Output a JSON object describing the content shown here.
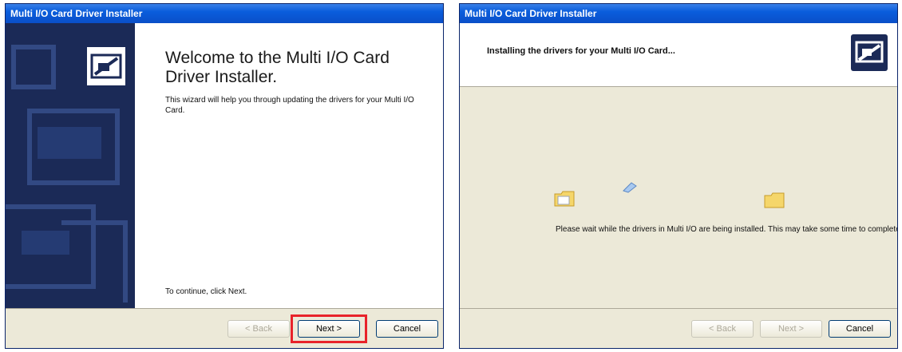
{
  "dialog1": {
    "title": "Multi I/O Card Driver Installer",
    "heading": "Welcome to the Multi I/O Card Driver Installer.",
    "intro": "This wizard will help you through updating the drivers for your Multi I/O Card.",
    "continue_hint": "To continue, click Next.",
    "buttons": {
      "back": "< Back",
      "next": "Next >",
      "cancel": "Cancel"
    }
  },
  "dialog2": {
    "title": "Multi I/O Card Driver Installer",
    "heading": "Installing the drivers for your Multi I/O Card...",
    "status": "Please wait while the drivers in Multi I/O are being installed. This may take some time to complete.",
    "buttons": {
      "back": "< Back",
      "next": "Next >",
      "cancel": "Cancel"
    }
  },
  "colors": {
    "titlebar": "#0a5ddc",
    "banner": "#1b2a57",
    "highlight": "#e8232a",
    "dialog_bg": "#ece9d8"
  },
  "icons": [
    "installer-icon",
    "folder-icon",
    "paper-icon"
  ]
}
